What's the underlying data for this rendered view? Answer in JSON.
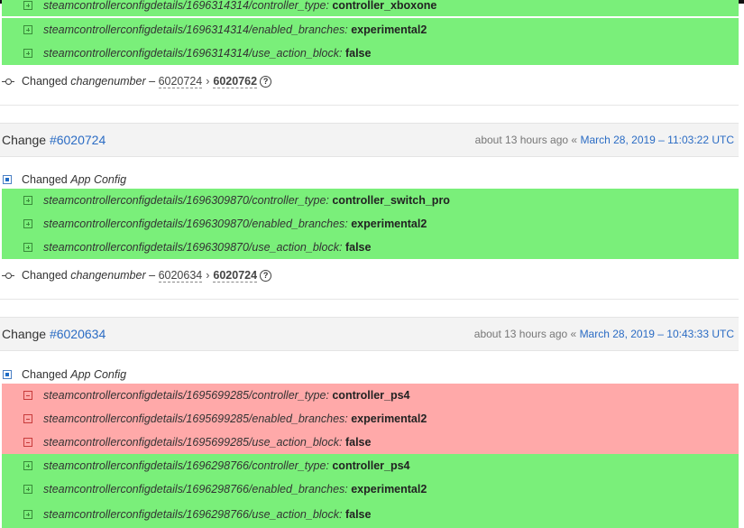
{
  "block0": {
    "added": [
      {
        "key": "steamcontrollerconfigdetails/1696314314/controller_type:",
        "value": "controller_xboxone"
      },
      {
        "key": "steamcontrollerconfigdetails/1696314314/enabled_branches:",
        "value": "experimental2"
      },
      {
        "key": "steamcontrollerconfigdetails/1696314314/use_action_block:",
        "value": "false"
      }
    ],
    "changenumber": {
      "label": "Changed",
      "field": "changenumber",
      "dash": "–",
      "from": "6020724",
      "arrow": "›",
      "to": "6020762",
      "help": "?"
    }
  },
  "change1": {
    "title_prefix": "Change",
    "number": "#6020724",
    "relative": "about 13 hours ago",
    "sep": "«",
    "date": "March 28, 2019 – 11:03:22 UTC",
    "config_label": "Changed",
    "config_name": "App Config",
    "added": [
      {
        "key": "steamcontrollerconfigdetails/1696309870/controller_type:",
        "value": "controller_switch_pro"
      },
      {
        "key": "steamcontrollerconfigdetails/1696309870/enabled_branches:",
        "value": "experimental2"
      },
      {
        "key": "steamcontrollerconfigdetails/1696309870/use_action_block:",
        "value": "false"
      }
    ],
    "changenumber": {
      "label": "Changed",
      "field": "changenumber",
      "dash": "–",
      "from": "6020634",
      "arrow": "›",
      "to": "6020724",
      "help": "?"
    }
  },
  "change2": {
    "title_prefix": "Change",
    "number": "#6020634",
    "relative": "about 13 hours ago",
    "sep": "«",
    "date": "March 28, 2019 – 10:43:33 UTC",
    "config_label": "Changed",
    "config_name": "App Config",
    "removed": [
      {
        "key": "steamcontrollerconfigdetails/1695699285/controller_type:",
        "value": "controller_ps4"
      },
      {
        "key": "steamcontrollerconfigdetails/1695699285/enabled_branches:",
        "value": "experimental2"
      },
      {
        "key": "steamcontrollerconfigdetails/1695699285/use_action_block:",
        "value": "false"
      }
    ],
    "added": [
      {
        "key": "steamcontrollerconfigdetails/1696298766/controller_type:",
        "value": "controller_ps4"
      },
      {
        "key": "steamcontrollerconfigdetails/1696298766/enabled_branches:",
        "value": "experimental2"
      },
      {
        "key": "steamcontrollerconfigdetails/1696298766/use_action_block:",
        "value": "false"
      }
    ]
  },
  "colors": {
    "added": "#7aef7a",
    "removed": "#ffa9a9",
    "link": "#2b6cc4"
  }
}
